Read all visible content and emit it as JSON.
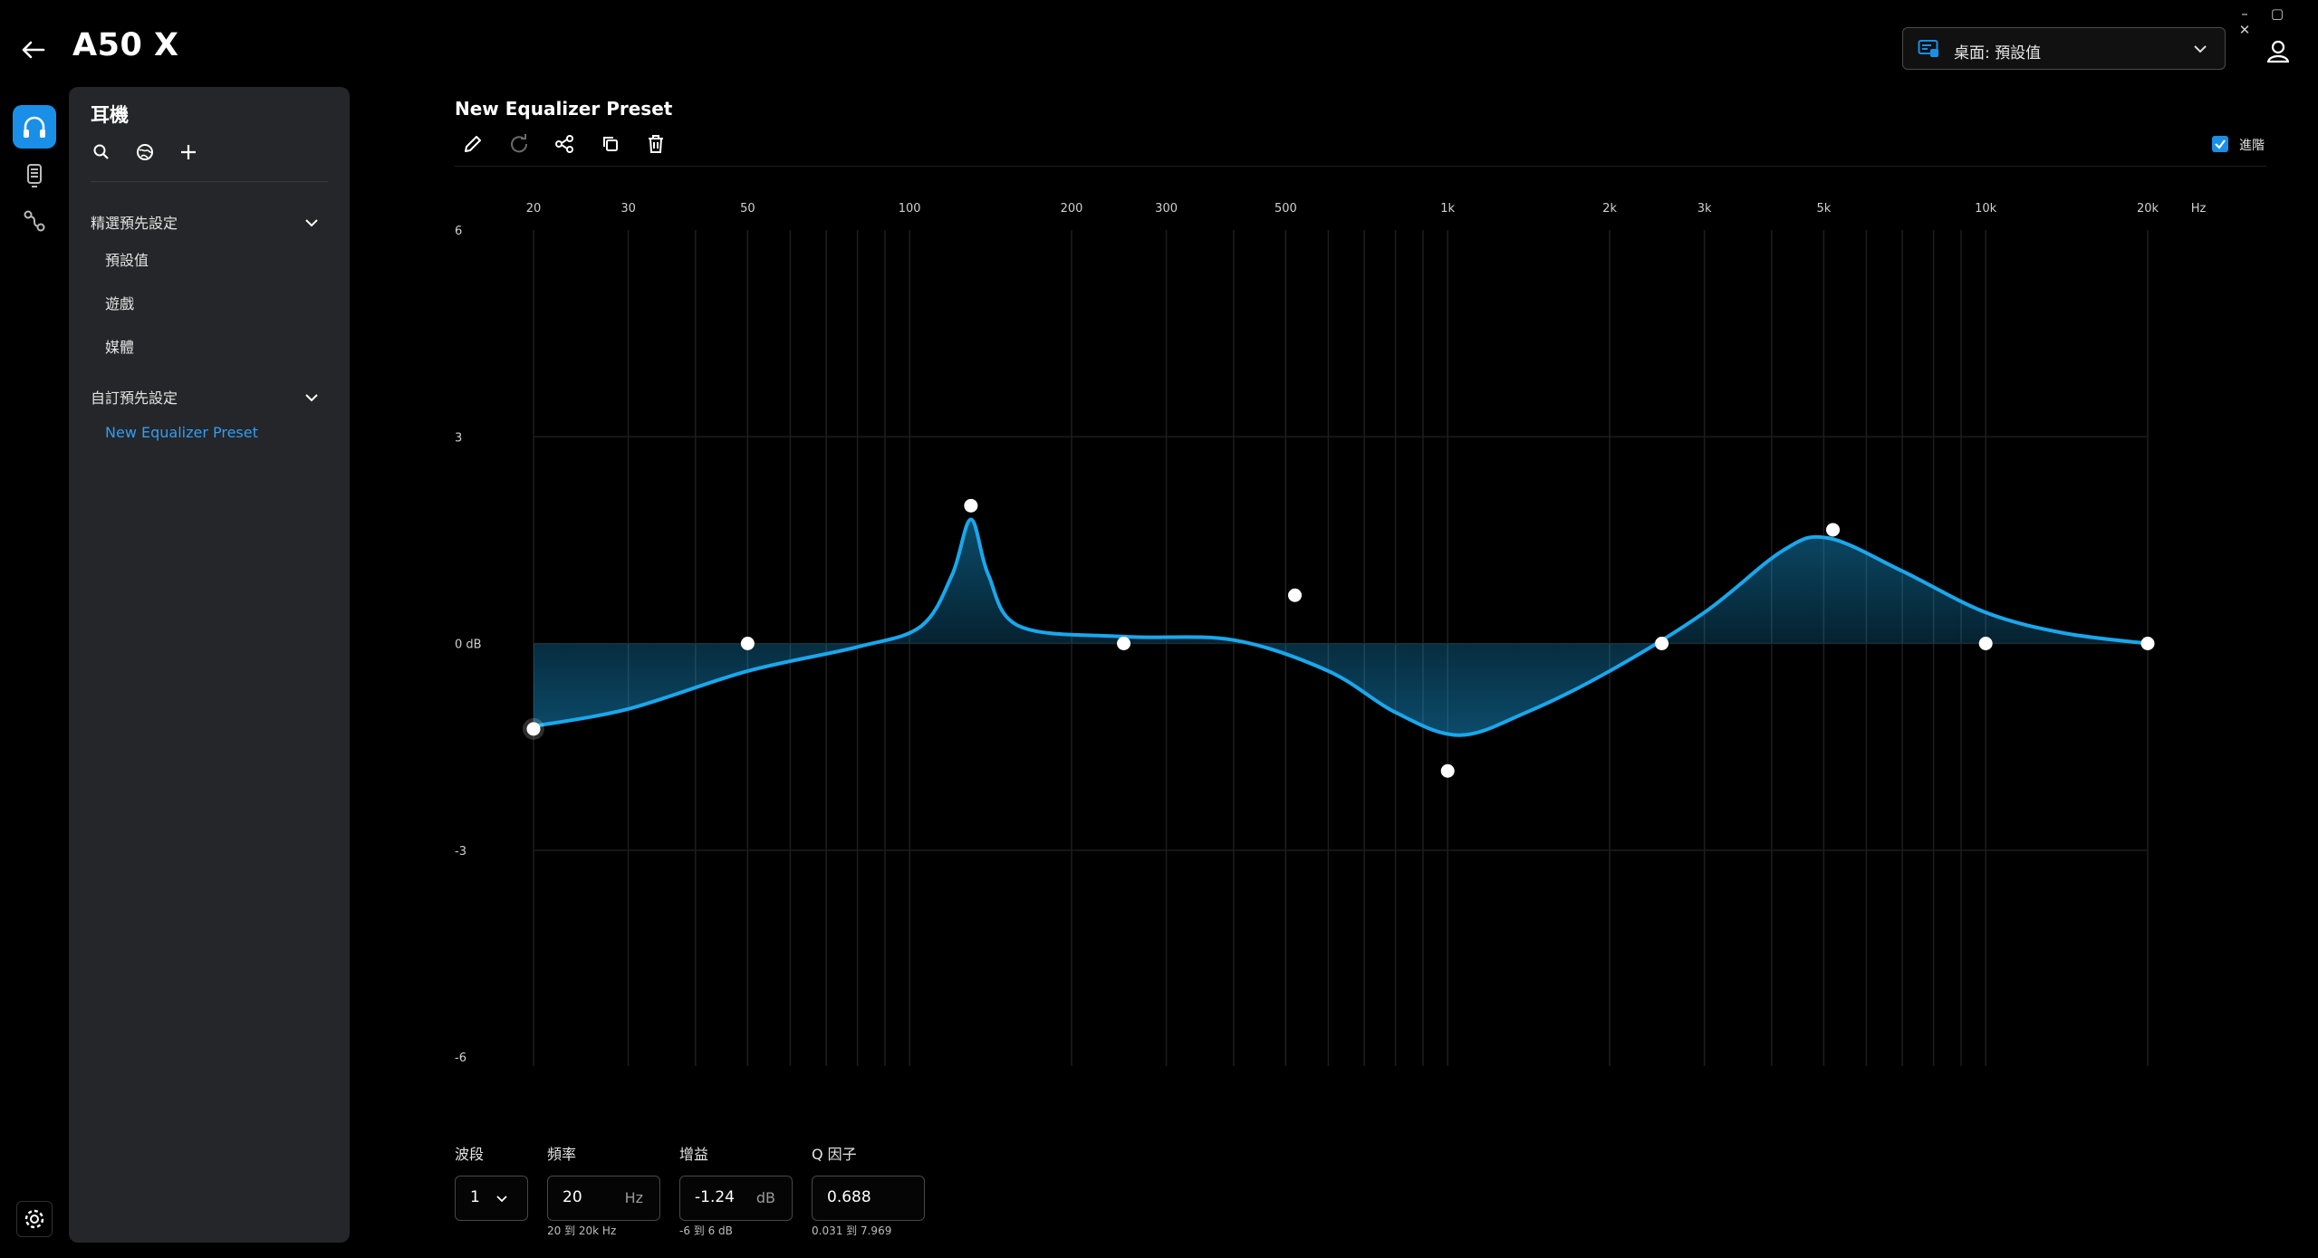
{
  "app": {
    "title": "A50 X",
    "window_controls": [
      "–",
      "▢",
      "✕"
    ]
  },
  "profile": {
    "label": "桌面: 預設值"
  },
  "sidebar": {
    "header": "耳機",
    "groups": [
      {
        "label": "精選預先設定",
        "items": [
          "預設值",
          "遊戲",
          "媒體"
        ]
      },
      {
        "label": "自訂預先設定",
        "items": [
          "New Equalizer Preset"
        ]
      }
    ],
    "active_item": "New Equalizer Preset"
  },
  "editor": {
    "preset_name": "New Equalizer Preset",
    "advanced_label": "進階",
    "advanced_checked": true
  },
  "chart_data": {
    "type": "line",
    "x_scale": "log",
    "x_unit_label": "Hz",
    "xlim": [
      20,
      20000
    ],
    "ylim": [
      -6,
      6
    ],
    "x_ticks": [
      {
        "v": 20,
        "label": "20"
      },
      {
        "v": 30,
        "label": "30"
      },
      {
        "v": 50,
        "label": "50"
      },
      {
        "v": 100,
        "label": "100"
      },
      {
        "v": 200,
        "label": "200"
      },
      {
        "v": 300,
        "label": "300"
      },
      {
        "v": 500,
        "label": "500"
      },
      {
        "v": 1000,
        "label": "1k"
      },
      {
        "v": 2000,
        "label": "2k"
      },
      {
        "v": 3000,
        "label": "3k"
      },
      {
        "v": 5000,
        "label": "5k"
      },
      {
        "v": 10000,
        "label": "10k"
      },
      {
        "v": 20000,
        "label": "20k"
      }
    ],
    "y_ticks": [
      {
        "v": 6,
        "label": "6"
      },
      {
        "v": 3,
        "label": "3"
      },
      {
        "v": 0,
        "label": "0 dB"
      },
      {
        "v": -3,
        "label": "-3"
      },
      {
        "v": -6,
        "label": "-6"
      }
    ],
    "bands": [
      {
        "freq": 20,
        "gain": -1.24
      },
      {
        "freq": 50,
        "gain": 0
      },
      {
        "freq": 130,
        "gain": 2.0
      },
      {
        "freq": 250,
        "gain": 0
      },
      {
        "freq": 520,
        "gain": 0.7
      },
      {
        "freq": 1000,
        "gain": -1.85
      },
      {
        "freq": 2500,
        "gain": 0
      },
      {
        "freq": 5200,
        "gain": 1.65
      },
      {
        "freq": 10000,
        "gain": 0
      },
      {
        "freq": 20000,
        "gain": 0
      }
    ],
    "response_curve": [
      {
        "freq": 20,
        "gain": -1.2
      },
      {
        "freq": 30,
        "gain": -0.95
      },
      {
        "freq": 50,
        "gain": -0.4
      },
      {
        "freq": 80,
        "gain": -0.05
      },
      {
        "freq": 105,
        "gain": 0.25
      },
      {
        "freq": 120,
        "gain": 1.0
      },
      {
        "freq": 130,
        "gain": 1.8
      },
      {
        "freq": 140,
        "gain": 1.0
      },
      {
        "freq": 160,
        "gain": 0.25
      },
      {
        "freq": 250,
        "gain": 0.1
      },
      {
        "freq": 400,
        "gain": 0.05
      },
      {
        "freq": 600,
        "gain": -0.4
      },
      {
        "freq": 800,
        "gain": -1.0
      },
      {
        "freq": 1050,
        "gain": -1.33
      },
      {
        "freq": 1400,
        "gain": -1.0
      },
      {
        "freq": 2000,
        "gain": -0.4
      },
      {
        "freq": 3000,
        "gain": 0.45
      },
      {
        "freq": 4200,
        "gain": 1.35
      },
      {
        "freq": 5100,
        "gain": 1.53
      },
      {
        "freq": 7000,
        "gain": 1.05
      },
      {
        "freq": 10000,
        "gain": 0.45
      },
      {
        "freq": 14000,
        "gain": 0.15
      },
      {
        "freq": 20000,
        "gain": 0.0
      }
    ],
    "selected_band": 1,
    "curve_color": "#1aa7ec",
    "point_color": "#ffffff"
  },
  "controls": {
    "band": {
      "label": "波段",
      "value": "1"
    },
    "frequency": {
      "label": "頻率",
      "value": "20",
      "unit": "Hz",
      "range": "20 到 20k Hz"
    },
    "gain": {
      "label": "增益",
      "value": "-1.24",
      "unit": "dB",
      "range": "-6 到 6 dB"
    },
    "q": {
      "label": "Q 因子",
      "value": "0.688",
      "range": "0.031 到 7.969"
    }
  }
}
